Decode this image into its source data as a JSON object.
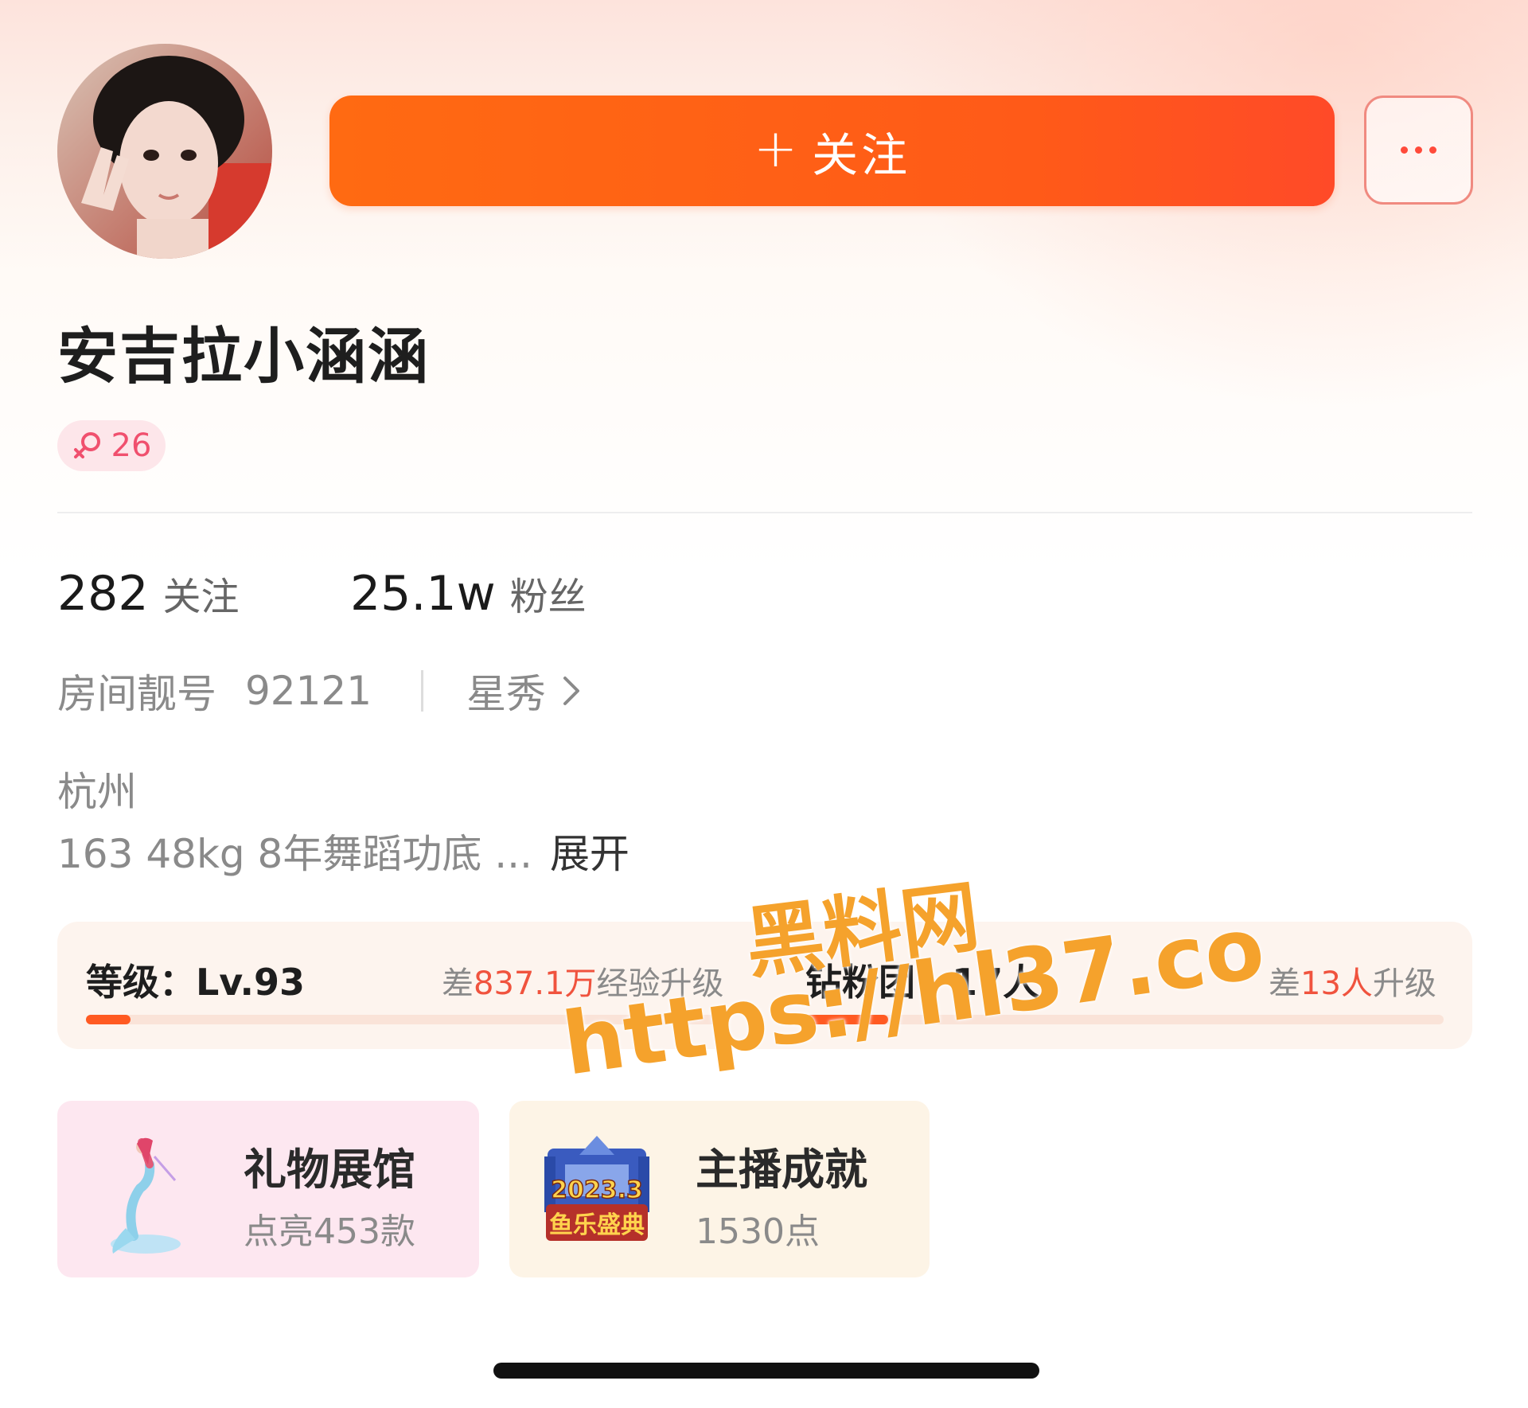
{
  "header": {
    "follow_plus": "+",
    "follow_label": "关注",
    "more_icon": "more-dots-icon"
  },
  "profile": {
    "name": "安吉拉小涵涵",
    "gender_icon": "female-icon",
    "age": "26"
  },
  "stats": {
    "following_count": "282",
    "following_label": "关注",
    "fans_count": "25.1w",
    "fans_label": "粉丝"
  },
  "meta": {
    "room_label": "房间靓号",
    "room_id": "92121",
    "category": "星秀"
  },
  "city": "杭州",
  "bio": {
    "text": "163 48kg 8年舞蹈功底 ...",
    "expand": "展开"
  },
  "level": {
    "title": "等级：Lv.93",
    "hint_prefix": "差",
    "hint_value": "837.1万",
    "hint_suffix": "经验升级",
    "progress": 0.07
  },
  "fan_club": {
    "title": "钻粉团：17人",
    "hint_prefix": "差",
    "hint_value": "13人",
    "hint_suffix": "升级",
    "progress": 0.13
  },
  "gift_hall": {
    "title": "礼物展馆",
    "subtitle": "点亮453款"
  },
  "achievement": {
    "title": "主播成就",
    "subtitle": "1530点",
    "badge_line1": "2023.3",
    "badge_line2": "鱼乐盛典"
  },
  "watermark": {
    "line1": "黑料网",
    "line2": "https://hl37.co"
  },
  "colors": {
    "accent": "#ff5a18",
    "highlight": "#f0533e",
    "female": "#f0506e",
    "watermark": "#f5a22c"
  }
}
